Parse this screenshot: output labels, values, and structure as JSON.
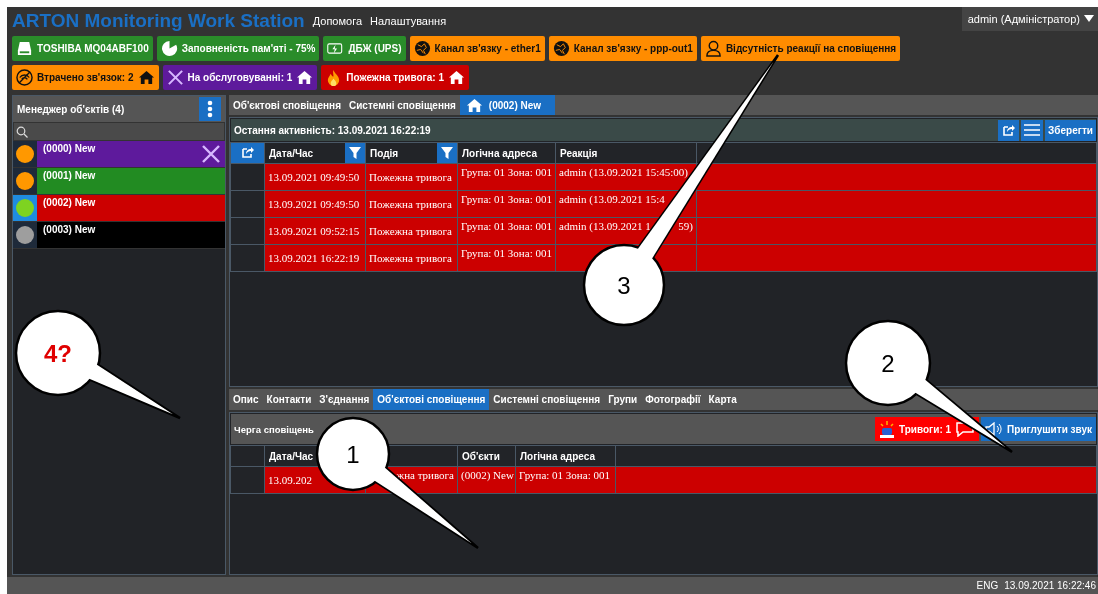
{
  "header": {
    "title": "ARTON Monitoring Work Station",
    "menu": [
      "Допомога",
      "Налаштування"
    ],
    "user": "admin (Адміністратор)"
  },
  "badge_rows": [
    [
      {
        "kind": "disk",
        "label": "TOSHIBA MQ04ABF100",
        "home_link": false
      },
      {
        "kind": "memory",
        "label": "Заповненість пам'яті - 75%",
        "home_link": false
      },
      {
        "kind": "ups",
        "label": "ДБЖ (UPS)",
        "home_link": false
      },
      {
        "kind": "channel",
        "label": "Канал зв'язку - ether1",
        "home_link": false
      },
      {
        "kind": "channel",
        "label": "Канал зв'язку - ppp-out1",
        "home_link": false
      },
      {
        "kind": "no-reaction",
        "label": "Відсутність реакції на сповіщення",
        "home_link": false
      }
    ],
    [
      {
        "kind": "lost",
        "label": "Втрачено зв'язок: 2",
        "home_link": true
      },
      {
        "kind": "service",
        "label": "На обслуговуванні: 1",
        "home_link": true
      },
      {
        "kind": "fire",
        "label": "Пожежна тривога: 1",
        "home_link": true
      }
    ]
  ],
  "object_manager": {
    "title": "Менеджер об'єктів (4)",
    "objects": [
      {
        "name": "(0000) New",
        "kind": "service",
        "color": "#ff9800",
        "selected": false,
        "service": true
      },
      {
        "name": "(0001) New",
        "kind": "ok",
        "color": "#ff9800",
        "selected": false,
        "service": false
      },
      {
        "name": "(0002) New",
        "kind": "alarm",
        "color": "#7ed321",
        "selected": true,
        "service": false
      },
      {
        "name": "(0003) New",
        "kind": "offline",
        "color": "#9e9e9e",
        "selected": false,
        "service": false
      }
    ]
  },
  "tabs": [
    {
      "label": "Об'єктові сповіщення",
      "selected": false,
      "home": false
    },
    {
      "label": "Системні сповіщення",
      "selected": false,
      "home": false
    },
    {
      "label": "(0002) New",
      "selected": true,
      "home": true
    }
  ],
  "activity": {
    "text": "Остання активність: 13.09.2021 16:22:19",
    "save": "Зберегти"
  },
  "events": {
    "columns": [
      "Дата/Час",
      "Подія",
      "Логічна адреса",
      "Реакція"
    ],
    "rows": [
      {
        "date": "13.09.2021 09:49:50",
        "event": "Пожежна тривога",
        "address": "Група: 01 Зона: 001",
        "reaction": "admin (13.09.2021 15:45:00)"
      },
      {
        "date": "13.09.2021 09:49:50",
        "event": "Пожежна тривога",
        "address": "Група: 01 Зона: 001",
        "reaction": "admin (13.09.2021 15:4"
      },
      {
        "date": "13.09.2021 09:52:15",
        "event": "Пожежна тривога",
        "address": "Група: 01 Зона: 001",
        "reaction": "admin (13.09.2021 1",
        "reaction_end": "59)"
      },
      {
        "date": "13.09.2021 16:22:19",
        "event": "Пожежна тривога",
        "address": "Група: 01 Зона: 001"
      }
    ]
  },
  "object_tabs": [
    {
      "label": "Опис",
      "selected": false
    },
    {
      "label": "Контакти",
      "selected": false
    },
    {
      "label": "З'єднання",
      "selected": false
    },
    {
      "label": "Об'єктові сповіщення",
      "selected": true
    },
    {
      "label": "Системні сповіщення",
      "selected": false
    },
    {
      "label": "Групи",
      "selected": false
    },
    {
      "label": "Фотографії",
      "selected": false
    },
    {
      "label": "Карта",
      "selected": false
    }
  ],
  "queue": {
    "title": "Черга сповіщень",
    "alarms": "Тривоги: 1",
    "mute": "Приглушити звук",
    "columns": [
      "Дата/Час",
      "Об'єкти",
      "Логічна адреса"
    ],
    "rows": [
      {
        "date": "13.09.202",
        "event": "жна тривога",
        "object": "(0002) New",
        "address": "Група: 01 Зона: 001"
      }
    ]
  },
  "status_bar": {
    "lang": "ENG",
    "time": "13.09.2021 16:22:46"
  },
  "callouts": [
    {
      "label": "3",
      "color": "#000000"
    },
    {
      "label": "4?",
      "color": "#e00000"
    },
    {
      "label": "2",
      "color": "#000000"
    },
    {
      "label": "1",
      "color": "#000000"
    }
  ]
}
